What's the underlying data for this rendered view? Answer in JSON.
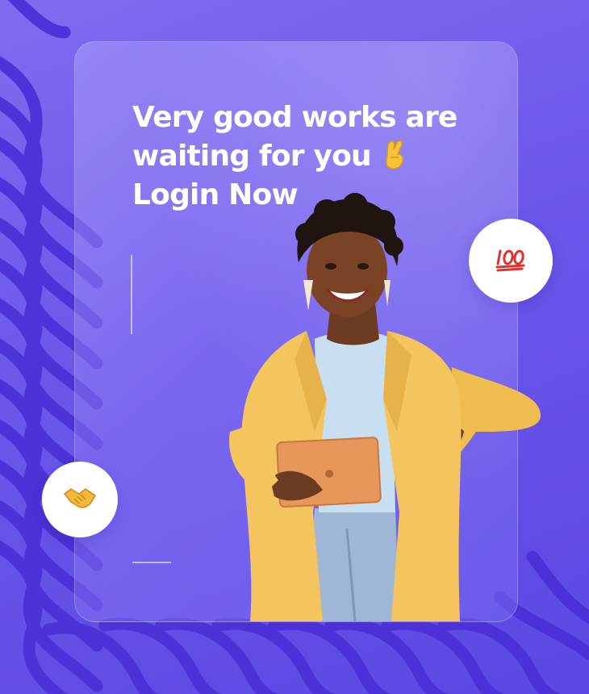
{
  "hero": {
    "headline_line1": "Very good works are",
    "headline_line2": "waiting for you",
    "headline_line3": "Login Now"
  },
  "badges": {
    "hundred_icon": "hundred-points-emoji",
    "handshake_icon": "handshake-emoji"
  },
  "colors": {
    "background": "#6a57ea",
    "wave": "#4a2fd6",
    "card_tint": "#a89cf8",
    "jacket": "#f4c55e",
    "text": "#ffffff"
  }
}
